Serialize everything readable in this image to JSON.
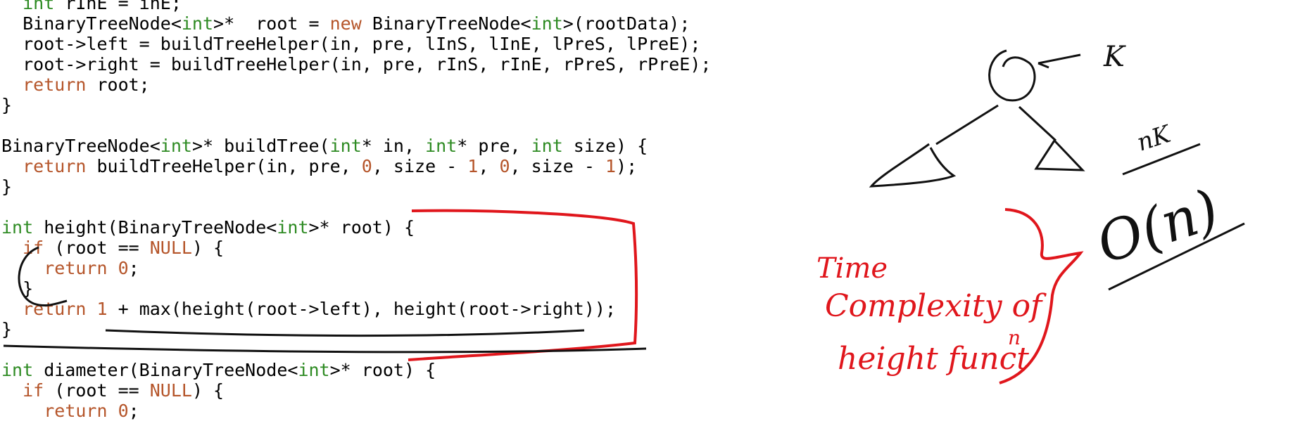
{
  "code_lines": [
    [
      {
        "t": "  "
      },
      {
        "t": "int",
        "c": "kw-type"
      },
      {
        "t": " rInE = inE;"
      }
    ],
    [
      {
        "t": "  BinaryTreeNode<"
      },
      {
        "t": "int",
        "c": "kw-type"
      },
      {
        "t": ">*  root = "
      },
      {
        "t": "new",
        "c": "kw-ctl"
      },
      {
        "t": " BinaryTreeNode<"
      },
      {
        "t": "int",
        "c": "kw-type"
      },
      {
        "t": ">(rootData);"
      }
    ],
    [
      {
        "t": "  root->left = buildTreeHelper(in, pre, lInS, lInE, lPreS, lPreE);"
      }
    ],
    [
      {
        "t": "  root->right = buildTreeHelper(in, pre, rInS, rInE, rPreS, rPreE);"
      }
    ],
    [
      {
        "t": "  "
      },
      {
        "t": "return",
        "c": "kw-ctl"
      },
      {
        "t": " root;"
      }
    ],
    [
      {
        "t": "}"
      }
    ],
    [
      {
        "t": ""
      }
    ],
    [
      {
        "t": "BinaryTreeNode<"
      },
      {
        "t": "int",
        "c": "kw-type"
      },
      {
        "t": ">* buildTree("
      },
      {
        "t": "int",
        "c": "kw-type"
      },
      {
        "t": "* in, "
      },
      {
        "t": "int",
        "c": "kw-type"
      },
      {
        "t": "* pre, "
      },
      {
        "t": "int",
        "c": "kw-type"
      },
      {
        "t": " size) {"
      }
    ],
    [
      {
        "t": "  "
      },
      {
        "t": "return",
        "c": "kw-ctl"
      },
      {
        "t": " buildTreeHelper(in, pre, "
      },
      {
        "t": "0",
        "c": "num"
      },
      {
        "t": ", size - "
      },
      {
        "t": "1",
        "c": "num"
      },
      {
        "t": ", "
      },
      {
        "t": "0",
        "c": "num"
      },
      {
        "t": ", size - "
      },
      {
        "t": "1",
        "c": "num"
      },
      {
        "t": ");"
      }
    ],
    [
      {
        "t": "}"
      }
    ],
    [
      {
        "t": ""
      }
    ],
    [
      {
        "t": "int",
        "c": "kw-type"
      },
      {
        "t": " height(BinaryTreeNode<"
      },
      {
        "t": "int",
        "c": "kw-type"
      },
      {
        "t": ">* root) {"
      }
    ],
    [
      {
        "t": "  "
      },
      {
        "t": "if",
        "c": "kw-ctl"
      },
      {
        "t": " (root == "
      },
      {
        "t": "NULL",
        "c": "null"
      },
      {
        "t": ") {"
      }
    ],
    [
      {
        "t": "    "
      },
      {
        "t": "return",
        "c": "kw-ctl"
      },
      {
        "t": " "
      },
      {
        "t": "0",
        "c": "num"
      },
      {
        "t": ";"
      }
    ],
    [
      {
        "t": "  }"
      }
    ],
    [
      {
        "t": "  "
      },
      {
        "t": "return",
        "c": "kw-ctl"
      },
      {
        "t": " "
      },
      {
        "t": "1",
        "c": "num"
      },
      {
        "t": " + max(height(root->left), height(root->right));"
      }
    ],
    [
      {
        "t": "}"
      }
    ],
    [
      {
        "t": ""
      }
    ],
    [
      {
        "t": "int",
        "c": "kw-type"
      },
      {
        "t": " diameter(BinaryTreeNode<"
      },
      {
        "t": "int",
        "c": "kw-type"
      },
      {
        "t": ">* root) {"
      }
    ],
    [
      {
        "t": "  "
      },
      {
        "t": "if",
        "c": "kw-ctl"
      },
      {
        "t": " (root == "
      },
      {
        "t": "NULL",
        "c": "null"
      },
      {
        "t": ") {"
      }
    ],
    [
      {
        "t": "    "
      },
      {
        "t": "return",
        "c": "kw-ctl"
      },
      {
        "t": " "
      },
      {
        "t": "0",
        "c": "num"
      },
      {
        "t": ";"
      }
    ]
  ],
  "annotations": {
    "time_line1": "Time",
    "time_line2": "Complexity of",
    "time_line3": "height funct",
    "time_superscript": "n",
    "big_o": "O(n)",
    "fraction_top": "nK",
    "node_label": "K"
  },
  "colors": {
    "type_keyword": "#2e8b23",
    "control_keyword": "#b5552a",
    "ink_red": "#e0161c",
    "ink_black": "#111111"
  }
}
